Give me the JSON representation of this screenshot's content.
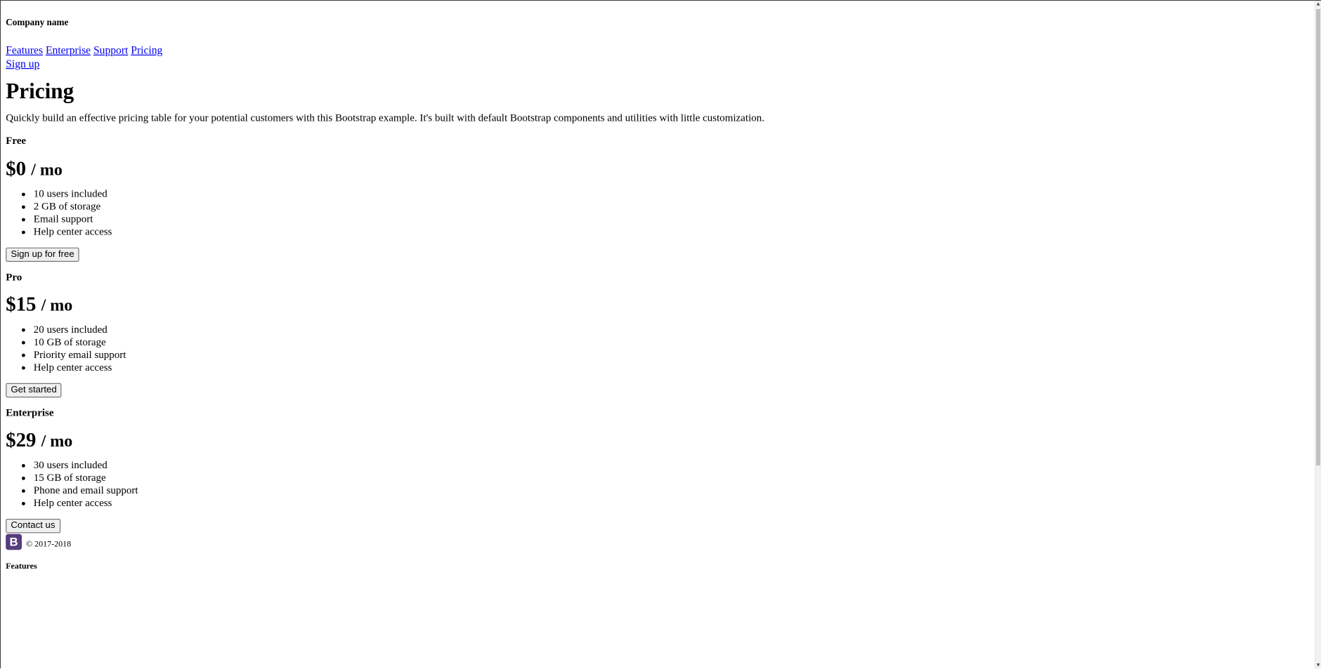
{
  "header": {
    "brand": "Company name",
    "nav": [
      "Features",
      "Enterprise",
      "Support",
      "Pricing"
    ],
    "signup": "Sign up"
  },
  "hero": {
    "title": "Pricing",
    "lead": "Quickly build an effective pricing table for your potential customers with this Bootstrap example. It's built with default Bootstrap components and utilities with little customization."
  },
  "plans": [
    {
      "name": "Free",
      "price": "$0",
      "per": "/ mo",
      "features": [
        "10 users included",
        "2 GB of storage",
        "Email support",
        "Help center access"
      ],
      "button": "Sign up for free"
    },
    {
      "name": "Pro",
      "price": "$15",
      "per": "/ mo",
      "features": [
        "20 users included",
        "10 GB of storage",
        "Priority email support",
        "Help center access"
      ],
      "button": "Get started"
    },
    {
      "name": "Enterprise",
      "price": "$29",
      "per": "/ mo",
      "features": [
        "30 users included",
        "15 GB of storage",
        "Phone and email support",
        "Help center access"
      ],
      "button": "Contact us"
    }
  ],
  "footer": {
    "logo_letter": "B",
    "logo_color": "#563d7c",
    "copyright": "© 2017-2018",
    "heading": "Features"
  }
}
